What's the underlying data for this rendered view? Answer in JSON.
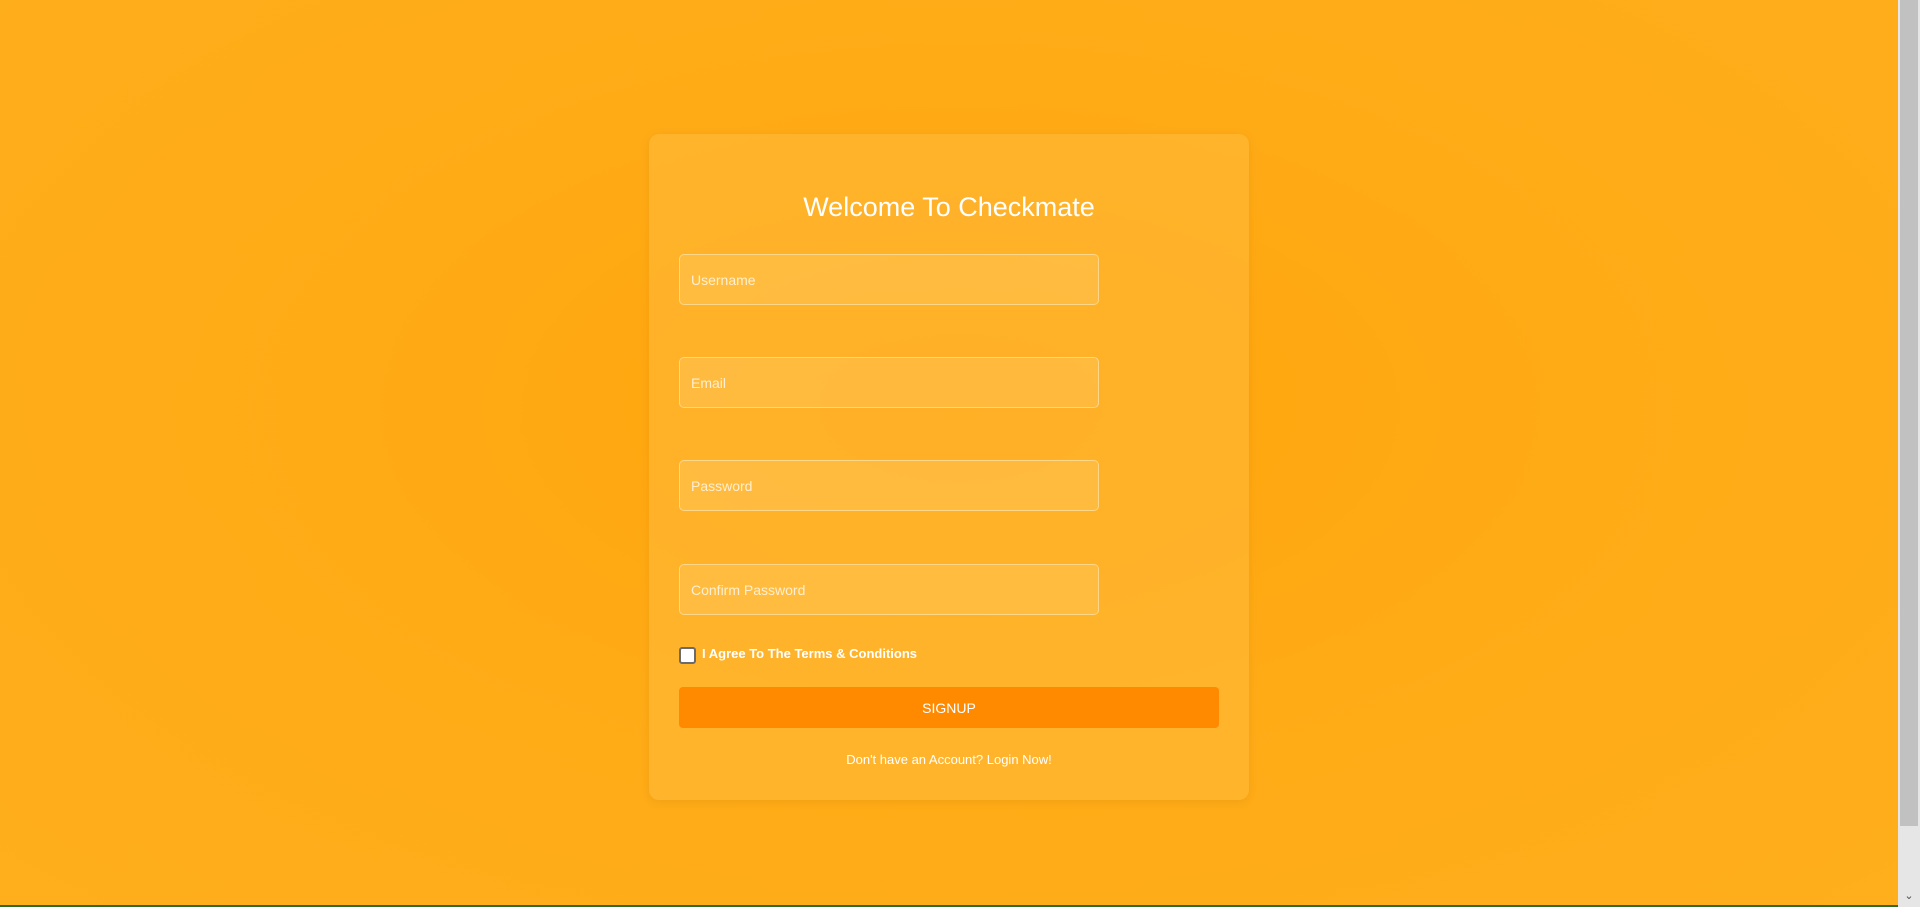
{
  "page": {
    "title": "Welcome To Checkmate",
    "background_color": "#FFA90F",
    "accent_color": "#FF8A00"
  },
  "form": {
    "username": {
      "placeholder": "Username",
      "value": ""
    },
    "email": {
      "placeholder": "Email",
      "value": ""
    },
    "password": {
      "placeholder": "Password",
      "value": ""
    },
    "confirm_password": {
      "placeholder": "Confirm Password",
      "value": ""
    },
    "terms_label": "I Agree To The Terms & Conditions",
    "terms_checked": false,
    "submit_label": "SIGNUP",
    "login_link": "Don't have an Account? Login Now!"
  },
  "scrollbar": {
    "arrow_icon": "chevron-down-icon"
  }
}
